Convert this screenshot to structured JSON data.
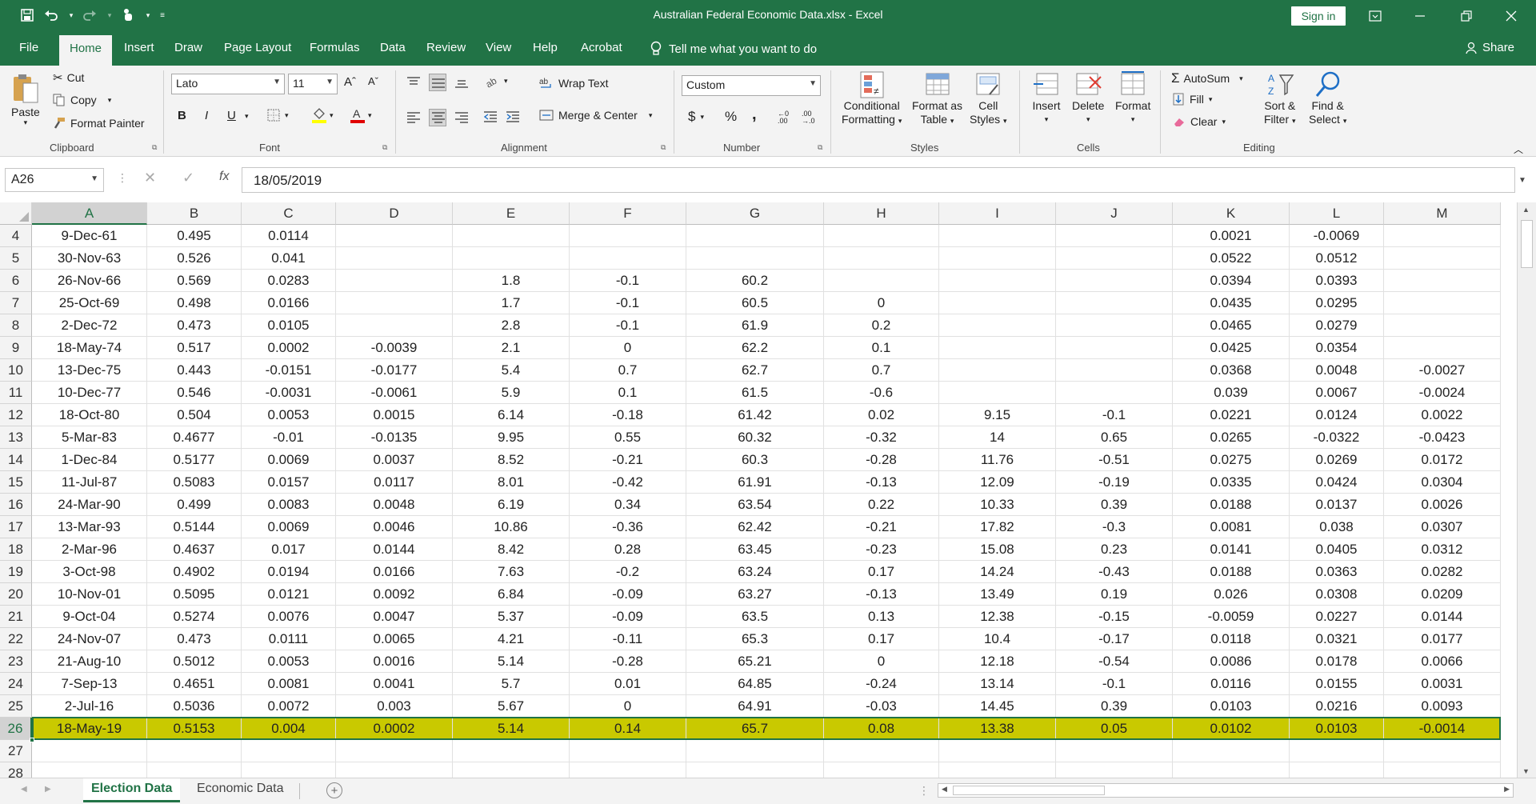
{
  "app": {
    "title": "Australian Federal Economic Data.xlsx  -  Excel",
    "signin": "Sign in",
    "share": "Share"
  },
  "menu": {
    "tabs": [
      "File",
      "Home",
      "Insert",
      "Draw",
      "Page Layout",
      "Formulas",
      "Data",
      "Review",
      "View",
      "Help",
      "Acrobat"
    ],
    "tell": "Tell me what you want to do"
  },
  "ribbon": {
    "clipboard": {
      "label": "Clipboard",
      "paste": "Paste",
      "cut": "Cut",
      "copy": "Copy",
      "format_painter": "Format Painter"
    },
    "font": {
      "label": "Font",
      "name": "Lato",
      "size": "11",
      "bold": "B",
      "italic": "I",
      "underline": "U",
      "grow": "Aˆ",
      "shrink": "Aˇ"
    },
    "alignment": {
      "label": "Alignment",
      "wrap": "Wrap Text",
      "merge": "Merge & Center"
    },
    "number": {
      "label": "Number",
      "format": "Custom",
      "currency": "$",
      "percent": "%",
      "comma": ","
    },
    "styles": {
      "label": "Styles",
      "conditional": "Conditional",
      "conditional2": "Formatting",
      "format_table": "Format as",
      "format_table2": "Table",
      "cell_styles": "Cell",
      "cell_styles2": "Styles"
    },
    "cells": {
      "label": "Cells",
      "insert": "Insert",
      "delete": "Delete",
      "format": "Format"
    },
    "editing": {
      "label": "Editing",
      "autosum": "AutoSum",
      "fill": "Fill",
      "clear": "Clear",
      "sort": "Sort &",
      "sort2": "Filter",
      "find": "Find &",
      "find2": "Select"
    }
  },
  "formula_bar": {
    "name_box": "A26",
    "formula": "18/05/2019",
    "fx": "fx"
  },
  "columns": [
    "A",
    "B",
    "C",
    "D",
    "E",
    "F",
    "G",
    "H",
    "I",
    "J",
    "K",
    "L",
    "M"
  ],
  "rows": [
    {
      "n": "4",
      "c": [
        "9-Dec-61",
        "0.495",
        "0.0114",
        "",
        "",
        "",
        "",
        "",
        "",
        "",
        "0.0021",
        "-0.0069",
        ""
      ]
    },
    {
      "n": "5",
      "c": [
        "30-Nov-63",
        "0.526",
        "0.041",
        "",
        "",
        "",
        "",
        "",
        "",
        "",
        "0.0522",
        "0.0512",
        ""
      ]
    },
    {
      "n": "6",
      "c": [
        "26-Nov-66",
        "0.569",
        "0.0283",
        "",
        "1.8",
        "-0.1",
        "60.2",
        "",
        "",
        "",
        "0.0394",
        "0.0393",
        ""
      ]
    },
    {
      "n": "7",
      "c": [
        "25-Oct-69",
        "0.498",
        "0.0166",
        "",
        "1.7",
        "-0.1",
        "60.5",
        "0",
        "",
        "",
        "0.0435",
        "0.0295",
        ""
      ]
    },
    {
      "n": "8",
      "c": [
        "2-Dec-72",
        "0.473",
        "0.0105",
        "",
        "2.8",
        "-0.1",
        "61.9",
        "0.2",
        "",
        "",
        "0.0465",
        "0.0279",
        ""
      ]
    },
    {
      "n": "9",
      "c": [
        "18-May-74",
        "0.517",
        "0.0002",
        "-0.0039",
        "2.1",
        "0",
        "62.2",
        "0.1",
        "",
        "",
        "0.0425",
        "0.0354",
        ""
      ]
    },
    {
      "n": "10",
      "c": [
        "13-Dec-75",
        "0.443",
        "-0.0151",
        "-0.0177",
        "5.4",
        "0.7",
        "62.7",
        "0.7",
        "",
        "",
        "0.0368",
        "0.0048",
        "-0.0027"
      ]
    },
    {
      "n": "11",
      "c": [
        "10-Dec-77",
        "0.546",
        "-0.0031",
        "-0.0061",
        "5.9",
        "0.1",
        "61.5",
        "-0.6",
        "",
        "",
        "0.039",
        "0.0067",
        "-0.0024"
      ]
    },
    {
      "n": "12",
      "c": [
        "18-Oct-80",
        "0.504",
        "0.0053",
        "0.0015",
        "6.14",
        "-0.18",
        "61.42",
        "0.02",
        "9.15",
        "-0.1",
        "0.0221",
        "0.0124",
        "0.0022"
      ]
    },
    {
      "n": "13",
      "c": [
        "5-Mar-83",
        "0.4677",
        "-0.01",
        "-0.0135",
        "9.95",
        "0.55",
        "60.32",
        "-0.32",
        "14",
        "0.65",
        "0.0265",
        "-0.0322",
        "-0.0423"
      ]
    },
    {
      "n": "14",
      "c": [
        "1-Dec-84",
        "0.5177",
        "0.0069",
        "0.0037",
        "8.52",
        "-0.21",
        "60.3",
        "-0.28",
        "11.76",
        "-0.51",
        "0.0275",
        "0.0269",
        "0.0172"
      ]
    },
    {
      "n": "15",
      "c": [
        "11-Jul-87",
        "0.5083",
        "0.0157",
        "0.0117",
        "8.01",
        "-0.42",
        "61.91",
        "-0.13",
        "12.09",
        "-0.19",
        "0.0335",
        "0.0424",
        "0.0304"
      ]
    },
    {
      "n": "16",
      "c": [
        "24-Mar-90",
        "0.499",
        "0.0083",
        "0.0048",
        "6.19",
        "0.34",
        "63.54",
        "0.22",
        "10.33",
        "0.39",
        "0.0188",
        "0.0137",
        "0.0026"
      ]
    },
    {
      "n": "17",
      "c": [
        "13-Mar-93",
        "0.5144",
        "0.0069",
        "0.0046",
        "10.86",
        "-0.36",
        "62.42",
        "-0.21",
        "17.82",
        "-0.3",
        "0.0081",
        "0.038",
        "0.0307"
      ]
    },
    {
      "n": "18",
      "c": [
        "2-Mar-96",
        "0.4637",
        "0.017",
        "0.0144",
        "8.42",
        "0.28",
        "63.45",
        "-0.23",
        "15.08",
        "0.23",
        "0.0141",
        "0.0405",
        "0.0312"
      ]
    },
    {
      "n": "19",
      "c": [
        "3-Oct-98",
        "0.4902",
        "0.0194",
        "0.0166",
        "7.63",
        "-0.2",
        "63.24",
        "0.17",
        "14.24",
        "-0.43",
        "0.0188",
        "0.0363",
        "0.0282"
      ]
    },
    {
      "n": "20",
      "c": [
        "10-Nov-01",
        "0.5095",
        "0.0121",
        "0.0092",
        "6.84",
        "-0.09",
        "63.27",
        "-0.13",
        "13.49",
        "0.19",
        "0.026",
        "0.0308",
        "0.0209"
      ]
    },
    {
      "n": "21",
      "c": [
        "9-Oct-04",
        "0.5274",
        "0.0076",
        "0.0047",
        "5.37",
        "-0.09",
        "63.5",
        "0.13",
        "12.38",
        "-0.15",
        "-0.0059",
        "0.0227",
        "0.0144"
      ]
    },
    {
      "n": "22",
      "c": [
        "24-Nov-07",
        "0.473",
        "0.0111",
        "0.0065",
        "4.21",
        "-0.11",
        "65.3",
        "0.17",
        "10.4",
        "-0.17",
        "0.0118",
        "0.0321",
        "0.0177"
      ]
    },
    {
      "n": "23",
      "c": [
        "21-Aug-10",
        "0.5012",
        "0.0053",
        "0.0016",
        "5.14",
        "-0.28",
        "65.21",
        "0",
        "12.18",
        "-0.54",
        "0.0086",
        "0.0178",
        "0.0066"
      ]
    },
    {
      "n": "24",
      "c": [
        "7-Sep-13",
        "0.4651",
        "0.0081",
        "0.0041",
        "5.7",
        "0.01",
        "64.85",
        "-0.24",
        "13.14",
        "-0.1",
        "0.0116",
        "0.0155",
        "0.0031"
      ]
    },
    {
      "n": "25",
      "c": [
        "2-Jul-16",
        "0.5036",
        "0.0072",
        "0.003",
        "5.67",
        "0",
        "64.91",
        "-0.03",
        "14.45",
        "0.39",
        "0.0103",
        "0.0216",
        "0.0093"
      ]
    },
    {
      "n": "26",
      "c": [
        "18-May-19",
        "0.5153",
        "0.004",
        "0.0002",
        "5.14",
        "0.14",
        "65.7",
        "0.08",
        "13.38",
        "0.05",
        "0.0102",
        "0.0103",
        "-0.0014"
      ]
    },
    {
      "n": "27",
      "c": [
        "",
        "",
        "",
        "",
        "",
        "",
        "",
        "",
        "",
        "",
        "",
        "",
        ""
      ]
    },
    {
      "n": "28",
      "c": [
        "",
        "",
        "",
        "",
        "",
        "",
        "",
        "",
        "",
        "",
        "",
        "",
        ""
      ]
    }
  ],
  "sheets": {
    "tabs": [
      "Election Data",
      "Economic Data"
    ],
    "add": "+"
  },
  "colors": {
    "excel_green": "#217346",
    "selected_row_fill": "#c9c900"
  }
}
